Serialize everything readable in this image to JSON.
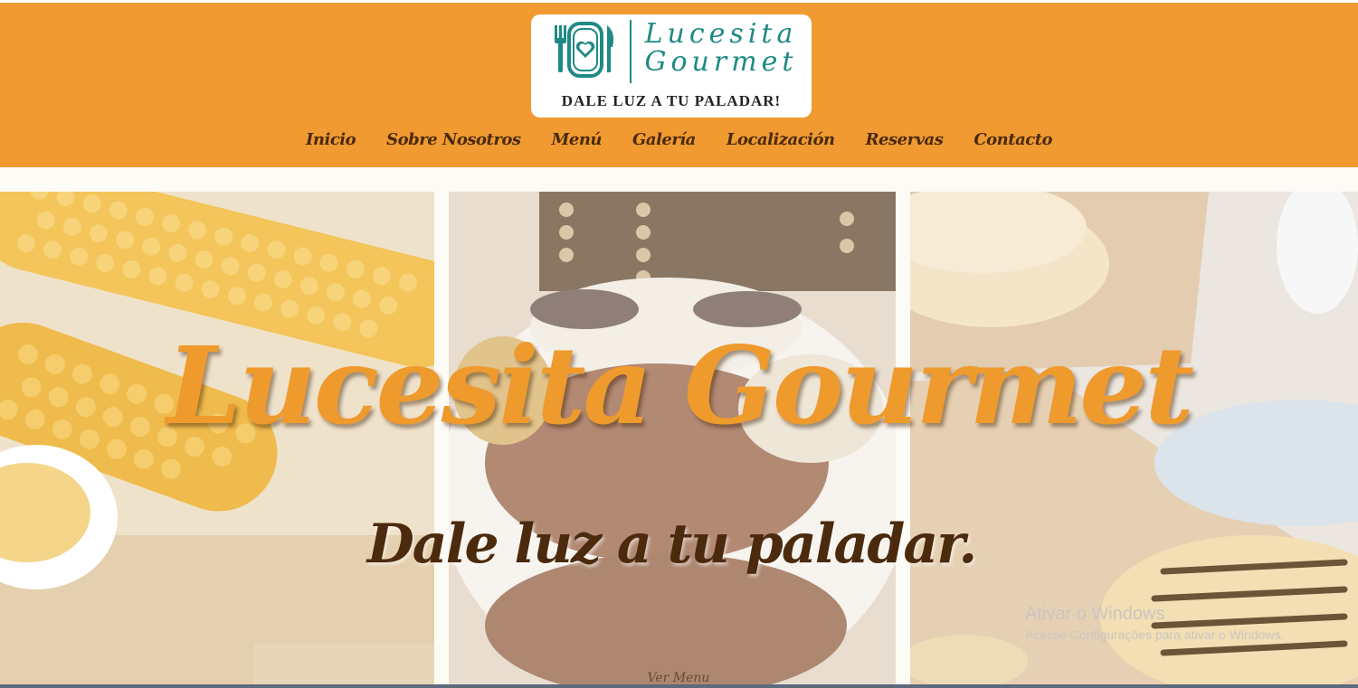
{
  "logo": {
    "name_line1": "Lucesita",
    "name_line2": "Gourmet",
    "tagline": "DALE LUZ A TU PALADAR!",
    "icon": "plate-fork-knife-heart-icon"
  },
  "nav": {
    "items": [
      {
        "label": "Inicio"
      },
      {
        "label": "Sobre Nosotros"
      },
      {
        "label": "Menú"
      },
      {
        "label": "Galería"
      },
      {
        "label": "Localización"
      },
      {
        "label": "Reservas"
      },
      {
        "label": "Contacto"
      }
    ]
  },
  "hero": {
    "title": "Lucesita Gourmet",
    "subtitle": "Dale luz a tu paladar.",
    "more_link": "Ver Menu",
    "images": [
      "corn-photo",
      "shredded-beef-rice-plate-photo",
      "arepas-photo"
    ]
  },
  "watermark": {
    "line1": "Ativar o Windows",
    "line2": "Acesse Configurações para ativar o Windows."
  },
  "colors": {
    "header_bg": "#f19a31",
    "logo_teal": "#1f8a84",
    "nav_text": "#4a2a0c",
    "title_orange": "#ef9a2d",
    "subtitle_brown": "#4b2a0d"
  }
}
